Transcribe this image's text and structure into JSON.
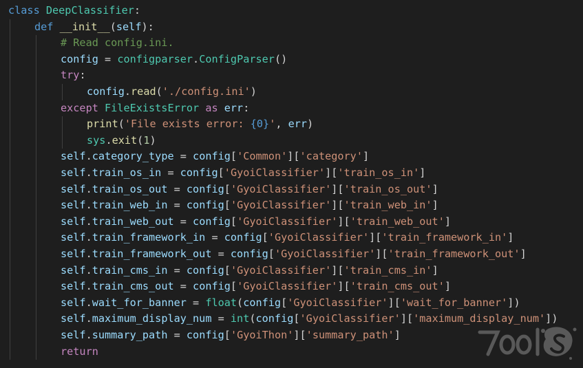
{
  "code": {
    "lines": [
      {
        "indent": 0,
        "tokens": [
          {
            "t": "class ",
            "c": "kw"
          },
          {
            "t": "DeepClassifier",
            "c": "cls"
          },
          {
            "t": ":",
            "c": "txt"
          }
        ]
      },
      {
        "indent": 1,
        "tokens": [
          {
            "t": "def ",
            "c": "kw"
          },
          {
            "t": "__init__",
            "c": "fn"
          },
          {
            "t": "(",
            "c": "txt"
          },
          {
            "t": "self",
            "c": "var"
          },
          {
            "t": "):",
            "c": "txt"
          }
        ]
      },
      {
        "indent": 2,
        "tokens": [
          {
            "t": "# Read config.ini.",
            "c": "cmt"
          }
        ]
      },
      {
        "indent": 2,
        "tokens": [
          {
            "t": "config",
            "c": "var"
          },
          {
            "t": " = ",
            "c": "txt"
          },
          {
            "t": "configparser",
            "c": "cls"
          },
          {
            "t": ".",
            "c": "txt"
          },
          {
            "t": "ConfigParser",
            "c": "cls"
          },
          {
            "t": "()",
            "c": "txt"
          }
        ]
      },
      {
        "indent": 2,
        "tokens": [
          {
            "t": "try",
            "c": "ctl"
          },
          {
            "t": ":",
            "c": "txt"
          }
        ]
      },
      {
        "indent": 3,
        "tokens": [
          {
            "t": "config",
            "c": "var"
          },
          {
            "t": ".",
            "c": "txt"
          },
          {
            "t": "read",
            "c": "fn"
          },
          {
            "t": "(",
            "c": "txt"
          },
          {
            "t": "'./config.ini'",
            "c": "str"
          },
          {
            "t": ")",
            "c": "txt"
          }
        ]
      },
      {
        "indent": 2,
        "tokens": [
          {
            "t": "except ",
            "c": "ctl"
          },
          {
            "t": "FileExistsError",
            "c": "cls"
          },
          {
            "t": " as ",
            "c": "ctl"
          },
          {
            "t": "err",
            "c": "var"
          },
          {
            "t": ":",
            "c": "txt"
          }
        ]
      },
      {
        "indent": 3,
        "tokens": [
          {
            "t": "print",
            "c": "fn"
          },
          {
            "t": "(",
            "c": "txt"
          },
          {
            "t": "'File exists error: ",
            "c": "str"
          },
          {
            "t": "{0}",
            "c": "kw"
          },
          {
            "t": "'",
            "c": "str"
          },
          {
            "t": ", ",
            "c": "txt"
          },
          {
            "t": "err",
            "c": "var"
          },
          {
            "t": ")",
            "c": "txt"
          }
        ]
      },
      {
        "indent": 3,
        "tokens": [
          {
            "t": "sys",
            "c": "cls"
          },
          {
            "t": ".",
            "c": "txt"
          },
          {
            "t": "exit",
            "c": "fn"
          },
          {
            "t": "(",
            "c": "txt"
          },
          {
            "t": "1",
            "c": "num"
          },
          {
            "t": ")",
            "c": "txt"
          }
        ]
      },
      {
        "indent": 2,
        "tokens": [
          {
            "t": "self",
            "c": "var"
          },
          {
            "t": ".",
            "c": "txt"
          },
          {
            "t": "category_type",
            "c": "var"
          },
          {
            "t": " = ",
            "c": "txt"
          },
          {
            "t": "config",
            "c": "var"
          },
          {
            "t": "[",
            "c": "txt"
          },
          {
            "t": "'Common'",
            "c": "str"
          },
          {
            "t": "][",
            "c": "txt"
          },
          {
            "t": "'category'",
            "c": "str"
          },
          {
            "t": "]",
            "c": "txt"
          }
        ]
      },
      {
        "indent": 2,
        "tokens": [
          {
            "t": "self",
            "c": "var"
          },
          {
            "t": ".",
            "c": "txt"
          },
          {
            "t": "train_os_in",
            "c": "var"
          },
          {
            "t": " = ",
            "c": "txt"
          },
          {
            "t": "config",
            "c": "var"
          },
          {
            "t": "[",
            "c": "txt"
          },
          {
            "t": "'GyoiClassifier'",
            "c": "str"
          },
          {
            "t": "][",
            "c": "txt"
          },
          {
            "t": "'train_os_in'",
            "c": "str"
          },
          {
            "t": "]",
            "c": "txt"
          }
        ]
      },
      {
        "indent": 2,
        "tokens": [
          {
            "t": "self",
            "c": "var"
          },
          {
            "t": ".",
            "c": "txt"
          },
          {
            "t": "train_os_out",
            "c": "var"
          },
          {
            "t": " = ",
            "c": "txt"
          },
          {
            "t": "config",
            "c": "var"
          },
          {
            "t": "[",
            "c": "txt"
          },
          {
            "t": "'GyoiClassifier'",
            "c": "str"
          },
          {
            "t": "][",
            "c": "txt"
          },
          {
            "t": "'train_os_out'",
            "c": "str"
          },
          {
            "t": "]",
            "c": "txt"
          }
        ]
      },
      {
        "indent": 2,
        "tokens": [
          {
            "t": "self",
            "c": "var"
          },
          {
            "t": ".",
            "c": "txt"
          },
          {
            "t": "train_web_in",
            "c": "var"
          },
          {
            "t": " = ",
            "c": "txt"
          },
          {
            "t": "config",
            "c": "var"
          },
          {
            "t": "[",
            "c": "txt"
          },
          {
            "t": "'GyoiClassifier'",
            "c": "str"
          },
          {
            "t": "][",
            "c": "txt"
          },
          {
            "t": "'train_web_in'",
            "c": "str"
          },
          {
            "t": "]",
            "c": "txt"
          }
        ]
      },
      {
        "indent": 2,
        "tokens": [
          {
            "t": "self",
            "c": "var"
          },
          {
            "t": ".",
            "c": "txt"
          },
          {
            "t": "train_web_out",
            "c": "var"
          },
          {
            "t": " = ",
            "c": "txt"
          },
          {
            "t": "config",
            "c": "var"
          },
          {
            "t": "[",
            "c": "txt"
          },
          {
            "t": "'GyoiClassifier'",
            "c": "str"
          },
          {
            "t": "][",
            "c": "txt"
          },
          {
            "t": "'train_web_out'",
            "c": "str"
          },
          {
            "t": "]",
            "c": "txt"
          }
        ]
      },
      {
        "indent": 2,
        "tokens": [
          {
            "t": "self",
            "c": "var"
          },
          {
            "t": ".",
            "c": "txt"
          },
          {
            "t": "train_framework_in",
            "c": "var"
          },
          {
            "t": " = ",
            "c": "txt"
          },
          {
            "t": "config",
            "c": "var"
          },
          {
            "t": "[",
            "c": "txt"
          },
          {
            "t": "'GyoiClassifier'",
            "c": "str"
          },
          {
            "t": "][",
            "c": "txt"
          },
          {
            "t": "'train_framework_in'",
            "c": "str"
          },
          {
            "t": "]",
            "c": "txt"
          }
        ]
      },
      {
        "indent": 2,
        "tokens": [
          {
            "t": "self",
            "c": "var"
          },
          {
            "t": ".",
            "c": "txt"
          },
          {
            "t": "train_framework_out",
            "c": "var"
          },
          {
            "t": " = ",
            "c": "txt"
          },
          {
            "t": "config",
            "c": "var"
          },
          {
            "t": "[",
            "c": "txt"
          },
          {
            "t": "'GyoiClassifier'",
            "c": "str"
          },
          {
            "t": "][",
            "c": "txt"
          },
          {
            "t": "'train_framework_out'",
            "c": "str"
          },
          {
            "t": "]",
            "c": "txt"
          }
        ]
      },
      {
        "indent": 2,
        "tokens": [
          {
            "t": "self",
            "c": "var"
          },
          {
            "t": ".",
            "c": "txt"
          },
          {
            "t": "train_cms_in",
            "c": "var"
          },
          {
            "t": " = ",
            "c": "txt"
          },
          {
            "t": "config",
            "c": "var"
          },
          {
            "t": "[",
            "c": "txt"
          },
          {
            "t": "'GyoiClassifier'",
            "c": "str"
          },
          {
            "t": "][",
            "c": "txt"
          },
          {
            "t": "'train_cms_in'",
            "c": "str"
          },
          {
            "t": "]",
            "c": "txt"
          }
        ]
      },
      {
        "indent": 2,
        "tokens": [
          {
            "t": "self",
            "c": "var"
          },
          {
            "t": ".",
            "c": "txt"
          },
          {
            "t": "train_cms_out",
            "c": "var"
          },
          {
            "t": " = ",
            "c": "txt"
          },
          {
            "t": "config",
            "c": "var"
          },
          {
            "t": "[",
            "c": "txt"
          },
          {
            "t": "'GyoiClassifier'",
            "c": "str"
          },
          {
            "t": "][",
            "c": "txt"
          },
          {
            "t": "'train_cms_out'",
            "c": "str"
          },
          {
            "t": "]",
            "c": "txt"
          }
        ]
      },
      {
        "indent": 2,
        "tokens": [
          {
            "t": "self",
            "c": "var"
          },
          {
            "t": ".",
            "c": "txt"
          },
          {
            "t": "wait_for_banner",
            "c": "var"
          },
          {
            "t": " = ",
            "c": "txt"
          },
          {
            "t": "float",
            "c": "cls"
          },
          {
            "t": "(",
            "c": "txt"
          },
          {
            "t": "config",
            "c": "var"
          },
          {
            "t": "[",
            "c": "txt"
          },
          {
            "t": "'GyoiClassifier'",
            "c": "str"
          },
          {
            "t": "][",
            "c": "txt"
          },
          {
            "t": "'wait_for_banner'",
            "c": "str"
          },
          {
            "t": "])",
            "c": "txt"
          }
        ]
      },
      {
        "indent": 2,
        "tokens": [
          {
            "t": "self",
            "c": "var"
          },
          {
            "t": ".",
            "c": "txt"
          },
          {
            "t": "maximum_display_num",
            "c": "var"
          },
          {
            "t": " = ",
            "c": "txt"
          },
          {
            "t": "int",
            "c": "cls"
          },
          {
            "t": "(",
            "c": "txt"
          },
          {
            "t": "config",
            "c": "var"
          },
          {
            "t": "[",
            "c": "txt"
          },
          {
            "t": "'GyoiClassifier'",
            "c": "str"
          },
          {
            "t": "][",
            "c": "txt"
          },
          {
            "t": "'maximum_display_num'",
            "c": "str"
          },
          {
            "t": "])",
            "c": "txt"
          }
        ]
      },
      {
        "indent": 2,
        "tokens": [
          {
            "t": "self",
            "c": "var"
          },
          {
            "t": ".",
            "c": "txt"
          },
          {
            "t": "summary_path",
            "c": "var"
          },
          {
            "t": " = ",
            "c": "txt"
          },
          {
            "t": "config",
            "c": "var"
          },
          {
            "t": "[",
            "c": "txt"
          },
          {
            "t": "'GyoiThon'",
            "c": "str"
          },
          {
            "t": "][",
            "c": "txt"
          },
          {
            "t": "'summary_path'",
            "c": "str"
          },
          {
            "t": "]",
            "c": "txt"
          }
        ]
      },
      {
        "indent": 2,
        "tokens": [
          {
            "t": "return",
            "c": "ctl"
          }
        ]
      }
    ]
  },
  "watermark": {
    "text": "7ools"
  },
  "colors": {
    "background": "#1e1e1e",
    "keyword": "#569cd6",
    "control": "#c586c0",
    "type": "#4ec9b0",
    "function": "#dcdcaa",
    "variable": "#9cdcfe",
    "string": "#ce9178",
    "number": "#b5cea8",
    "comment": "#6a9955"
  }
}
